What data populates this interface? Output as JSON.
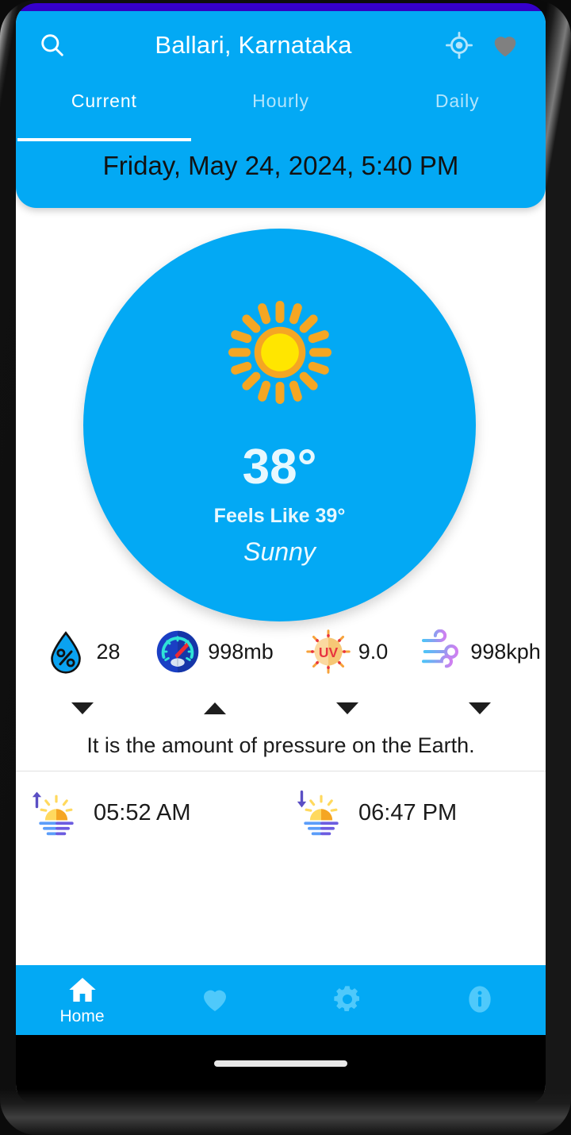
{
  "header": {
    "search_icon": "search-icon",
    "city": "Ballari, Karnataka",
    "gps_icon": "gps-location-icon",
    "favorite_icon": "heart-icon",
    "favorite_color": "#808080",
    "accent_color": "#03a9f4",
    "status_bar_color": "#3600cc"
  },
  "tabs": [
    {
      "label": "Current",
      "active": true
    },
    {
      "label": "Hourly",
      "active": false
    },
    {
      "label": "Daily",
      "active": false
    }
  ],
  "date": "Friday, May 24, 2024, 5:40 PM",
  "current": {
    "weather_icon": "sun-icon",
    "temperature": "38°",
    "feels_like": "Feels Like 39°",
    "condition": "Sunny"
  },
  "metrics": [
    {
      "icon": "humidity-droplet-icon",
      "value": "28",
      "expanded": false
    },
    {
      "icon": "pressure-gauge-icon",
      "value": "998mb",
      "expanded": true
    },
    {
      "icon": "uv-index-icon",
      "value": "9.0",
      "expanded": false
    },
    {
      "icon": "wind-icon",
      "value": "998kph",
      "expanded": false
    }
  ],
  "metric_description": "It is the amount of pressure on the Earth.",
  "sun": {
    "sunrise_icon": "sunrise-icon",
    "sunrise": "05:52 AM",
    "sunset_icon": "sunset-icon",
    "sunset": "06:47 PM"
  },
  "bottom_nav": [
    {
      "icon": "home-icon",
      "label": "Home",
      "active": true
    },
    {
      "icon": "heart-icon",
      "label": "",
      "active": false
    },
    {
      "icon": "gear-icon",
      "label": "",
      "active": false
    },
    {
      "icon": "info-icon",
      "label": "",
      "active": false
    }
  ]
}
